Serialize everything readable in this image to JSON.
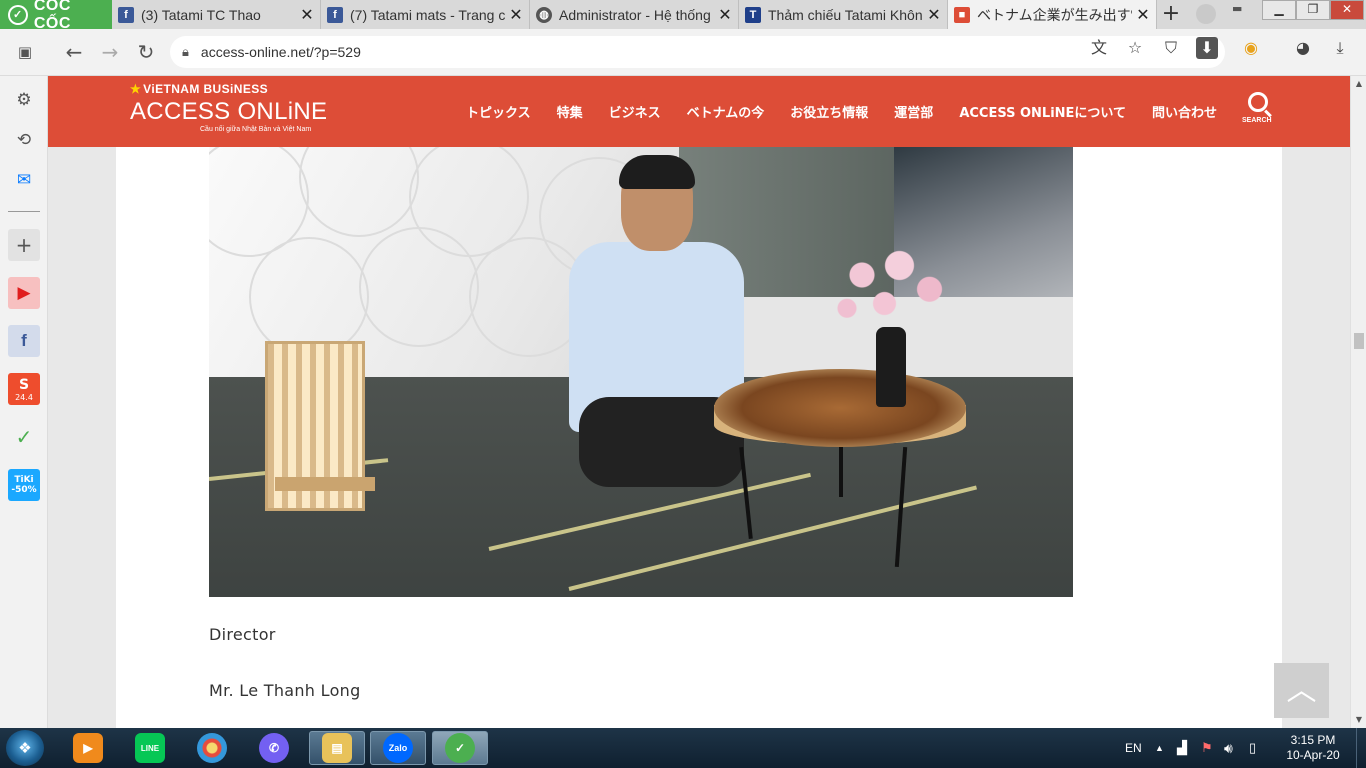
{
  "browser": {
    "brand": "CỐC CỐC",
    "tabs": [
      {
        "title": "(3) Tatami TC Thao",
        "favicon": "facebook-icon",
        "favicon_text": "f",
        "color": "#3b5998"
      },
      {
        "title": "(7) Tatami mats - Trang c",
        "favicon": "facebook-icon",
        "favicon_text": "f",
        "color": "#3b5998"
      },
      {
        "title": "Administrator - Hệ thống",
        "favicon": "globe-icon",
        "favicon_text": "◍",
        "color": "#555555"
      },
      {
        "title": "Thảm chiếu Tatami Khôn",
        "favicon": "site-icon",
        "favicon_text": "T",
        "color": "#1f3f8a"
      },
      {
        "title": "ベトナム企業が生み出す\"JA",
        "favicon": "access-online-icon",
        "favicon_text": "■",
        "color": "#dd4d37"
      }
    ],
    "new_tab": "+",
    "address": "access-online.net/?p=529"
  },
  "site": {
    "kicker": "ViETNAM BUSiNESS",
    "logo": "ACCESS ONLiNE",
    "tagline": "Cầu nối giữa Nhật Bản và Việt Nam",
    "nav": [
      "トピックス",
      "特集",
      "ビジネス",
      "ベトナムの今",
      "お役立ち情報",
      "運営部",
      "ACCESS ONLiNEについて",
      "問い合わせ"
    ],
    "search_label": "SEARCH",
    "accent": "#dd4d37"
  },
  "article": {
    "caption_role": "Director",
    "caption_name": "Mr. Le Thanh Long"
  },
  "sidebar": {
    "badges": {
      "shopee": "24.4",
      "tiki": "TiKi",
      "tiki_sale": "-50%"
    }
  },
  "taskbar": {
    "apps": [
      "media-player-icon",
      "line-icon",
      "paint-icon",
      "viber-icon",
      "file-explorer-icon",
      "zalo-icon",
      "coccoc-icon"
    ],
    "zalo_label": "Zalo",
    "line_label": "LINE",
    "language": "EN",
    "time": "3:15 PM",
    "date": "10-Apr-20"
  }
}
